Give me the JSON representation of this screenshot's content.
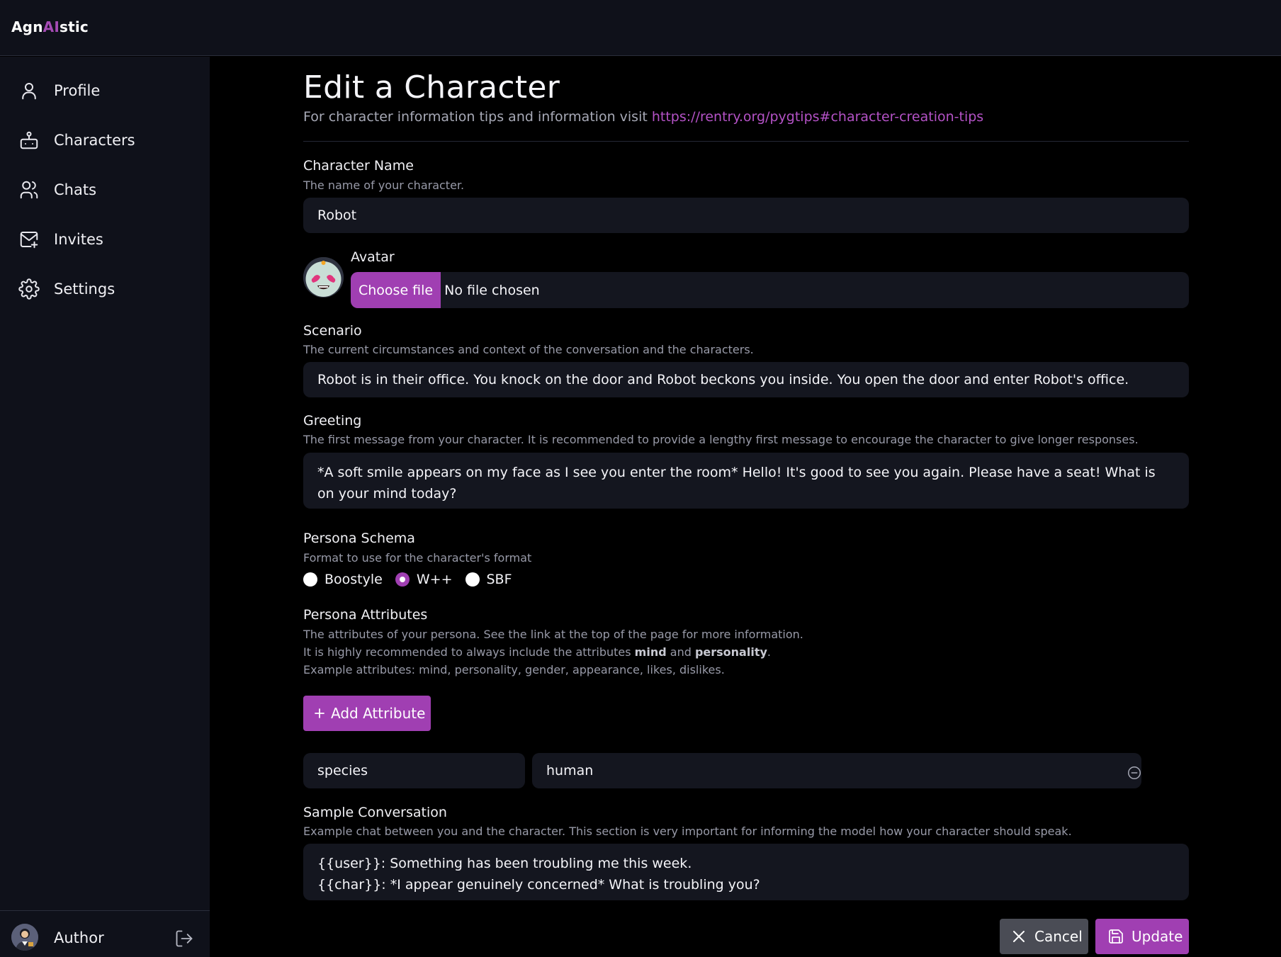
{
  "app": {
    "logo_prefix": "Agn",
    "logo_ai": "AI",
    "logo_suffix": "stic"
  },
  "sidebar": {
    "items": [
      {
        "label": "Profile",
        "icon": "user-icon"
      },
      {
        "label": "Characters",
        "icon": "bot-icon"
      },
      {
        "label": "Chats",
        "icon": "users-icon"
      },
      {
        "label": "Invites",
        "icon": "mail-plus-icon"
      },
      {
        "label": "Settings",
        "icon": "gear-icon"
      }
    ],
    "user": {
      "name": "Author",
      "logout_icon": "logout-icon"
    }
  },
  "page": {
    "title": "Edit a Character",
    "subtitle": "For character information tips and information visit ",
    "tips_link": "https://rentry.org/pygtips#character-creation-tips"
  },
  "form": {
    "name": {
      "label": "Character Name",
      "help": "The name of your character.",
      "value": "Robot"
    },
    "avatar": {
      "label": "Avatar",
      "button": "Choose file",
      "status": "No file chosen"
    },
    "scenario": {
      "label": "Scenario",
      "help": "The current circumstances and context of the conversation and the characters.",
      "value": "Robot is in their office. You knock on the door and Robot beckons you inside. You open the door and enter Robot's office."
    },
    "greeting": {
      "label": "Greeting",
      "help": "The first message from your character. It is recommended to provide a lengthy first message to encourage the character to give longer responses.",
      "value": "*A soft smile appears on my face as I see you enter the room* Hello! It's good to see you again. Please have a seat! What is on your mind today?"
    },
    "schema": {
      "label": "Persona Schema",
      "help": "Format to use for the character's format",
      "options": [
        "Boostyle",
        "W++",
        "SBF"
      ],
      "selected": "W++"
    },
    "attributes": {
      "label": "Persona Attributes",
      "help_line1": "The attributes of your persona. See the link at the top of the page for more information.",
      "help_line2_a": "It is highly recommended to always include the attributes ",
      "help_line2_b": "mind",
      "help_line2_c": " and ",
      "help_line2_d": "personality",
      "help_line2_e": ".",
      "help_line3": "Example attributes: mind, personality, gender, appearance, likes, dislikes.",
      "add_button": "Add Attribute",
      "rows": [
        {
          "key": "species",
          "value": "human"
        }
      ]
    },
    "sample": {
      "label": "Sample Conversation",
      "help": "Example chat between you and the character. This section is very important for informing the model how your character should speak.",
      "value": "{{user}}: Something has been troubling me this week.\n{{char}}: *I appear genuinely concerned* What is troubling you?"
    }
  },
  "actions": {
    "cancel": "Cancel",
    "update": "Update"
  },
  "colors": {
    "accent": "#a03fb2",
    "link": "#b452c6",
    "panel": "#0f111a",
    "field": "#14161f"
  }
}
